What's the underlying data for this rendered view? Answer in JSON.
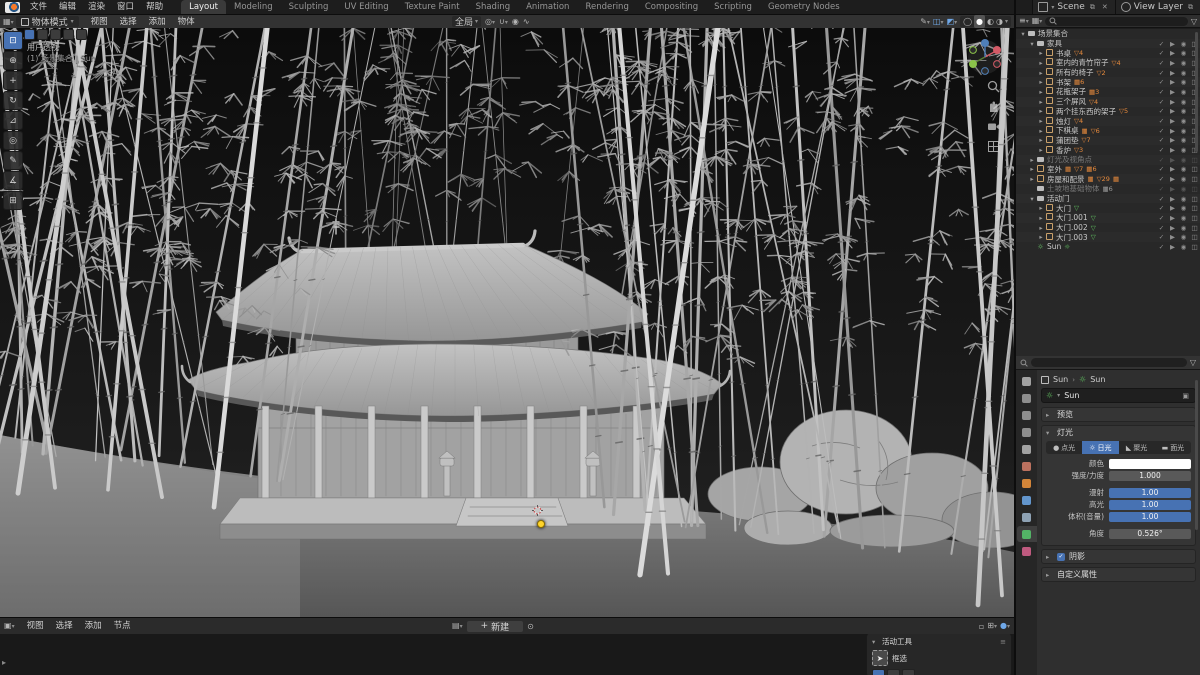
{
  "colors": {
    "accent": "#4772b3",
    "mesh_orange": "#e78a3c",
    "data_green": "#63c763",
    "sun_dot": "#ffd42a"
  },
  "topbar": {
    "menus": [
      "文件",
      "编辑",
      "渲染",
      "窗口",
      "帮助"
    ],
    "workspaces": [
      "Layout",
      "Modeling",
      "Sculpting",
      "UV Editing",
      "Texture Paint",
      "Shading",
      "Animation",
      "Rendering",
      "Compositing",
      "Scripting",
      "Geometry Nodes"
    ],
    "active_workspace": "Layout",
    "scene": "Scene",
    "view_layer": "View Layer"
  },
  "viewport_header": {
    "mode": "物体模式",
    "menus": [
      "视图",
      "选择",
      "添加",
      "物体"
    ],
    "orientation": "全局"
  },
  "viewport_overlay": {
    "view_label": "用户透视",
    "context_label": "(1) 场景集合 | Sun"
  },
  "toolbar": {
    "active_tool": "select-box",
    "tools": [
      "select-box",
      "cursor",
      "move",
      "rotate",
      "scale",
      "transform",
      "annotate",
      "measure",
      "add-cube"
    ]
  },
  "outliner": {
    "rows": [
      {
        "label": "场景集合",
        "type": "collection",
        "depth": 0,
        "expand": "open",
        "toggles": false
      },
      {
        "label": "家具",
        "type": "collection",
        "depth": 1,
        "expand": "open"
      },
      {
        "label": "书桌",
        "type": "object",
        "depth": 2,
        "expand": "closed",
        "badges": [
          {
            "glyph": "mesh",
            "count": "4",
            "color": "orange"
          }
        ]
      },
      {
        "label": "室内的青竹帘子",
        "type": "object",
        "depth": 2,
        "expand": "closed",
        "badges": [
          {
            "glyph": "mesh",
            "count": "4",
            "color": "orange"
          }
        ]
      },
      {
        "label": "所有的椅子",
        "type": "object",
        "depth": 2,
        "expand": "closed",
        "badges": [
          {
            "glyph": "mesh",
            "count": "2",
            "color": "orange"
          }
        ]
      },
      {
        "label": "书架",
        "type": "object",
        "depth": 2,
        "expand": "closed",
        "badges": [
          {
            "glyph": "img",
            "count": "6",
            "color": "orange"
          }
        ]
      },
      {
        "label": "花瓶架子",
        "type": "object",
        "depth": 2,
        "expand": "closed",
        "badges": [
          {
            "glyph": "img",
            "count": "3",
            "color": "orange"
          }
        ]
      },
      {
        "label": "三个屏风",
        "type": "object",
        "depth": 2,
        "expand": "closed",
        "badges": [
          {
            "glyph": "mesh",
            "count": "4",
            "color": "orange"
          }
        ]
      },
      {
        "label": "两个挂东西的架子",
        "type": "object",
        "depth": 2,
        "expand": "closed",
        "badges": [
          {
            "glyph": "mesh",
            "count": "5",
            "color": "orange"
          }
        ]
      },
      {
        "label": "烛灯",
        "type": "object",
        "depth": 2,
        "expand": "closed",
        "badges": [
          {
            "glyph": "mesh",
            "count": "4",
            "color": "orange"
          }
        ]
      },
      {
        "label": "下棋桌",
        "type": "object",
        "depth": 2,
        "expand": "closed",
        "badges": [
          {
            "glyph": "img",
            "count": "",
            "color": "orange"
          },
          {
            "glyph": "mesh",
            "count": "6",
            "color": "orange"
          }
        ]
      },
      {
        "label": "蒲团垫",
        "type": "object",
        "depth": 2,
        "expand": "closed",
        "badges": [
          {
            "glyph": "mesh",
            "count": "7",
            "color": "orange"
          }
        ]
      },
      {
        "label": "香炉",
        "type": "object",
        "depth": 2,
        "expand": "closed",
        "badges": [
          {
            "glyph": "mesh",
            "count": "3",
            "color": "orange"
          }
        ]
      },
      {
        "label": "灯光及视角点",
        "type": "collection",
        "depth": 1,
        "expand": "closed",
        "gray": true
      },
      {
        "label": "室外",
        "type": "object",
        "depth": 1,
        "expand": "closed",
        "badges": [
          {
            "glyph": "img",
            "count": "",
            "color": "orange"
          },
          {
            "glyph": "mesh",
            "count": "7",
            "color": "orange"
          },
          {
            "glyph": "img",
            "count": "6",
            "color": "orange"
          }
        ]
      },
      {
        "label": "房屋和配景",
        "type": "object",
        "depth": 1,
        "expand": "closed",
        "badges": [
          {
            "glyph": "img",
            "count": "",
            "color": "orange"
          },
          {
            "glyph": "mesh",
            "count": "29",
            "color": "orange"
          },
          {
            "glyph": "img",
            "count": "",
            "color": "orange"
          }
        ]
      },
      {
        "label": "土坡地基础物体",
        "type": "collection",
        "depth": 1,
        "expand": "none",
        "gray": true,
        "badges": [
          {
            "glyph": "img",
            "count": "6",
            "color": "gray"
          }
        ]
      },
      {
        "label": "活动门",
        "type": "collection",
        "depth": 1,
        "expand": "open"
      },
      {
        "label": "大门",
        "type": "object",
        "depth": 2,
        "expand": "closed",
        "badges": [
          {
            "glyph": "mesh",
            "count": "",
            "color": "green"
          }
        ]
      },
      {
        "label": "大门.001",
        "type": "object",
        "depth": 2,
        "expand": "closed",
        "badges": [
          {
            "glyph": "mesh",
            "count": "",
            "color": "green"
          }
        ]
      },
      {
        "label": "大门.002",
        "type": "object",
        "depth": 2,
        "expand": "closed",
        "badges": [
          {
            "glyph": "mesh",
            "count": "",
            "color": "green"
          }
        ]
      },
      {
        "label": "大门.003",
        "type": "object",
        "depth": 2,
        "expand": "closed",
        "badges": [
          {
            "glyph": "mesh",
            "count": "",
            "color": "green"
          }
        ]
      },
      {
        "label": "Sun",
        "type": "light",
        "depth": 1,
        "expand": "none",
        "badges": [
          {
            "glyph": "sun",
            "count": "",
            "color": "green"
          }
        ]
      }
    ]
  },
  "properties": {
    "active_tab": "object-data",
    "tabs": [
      {
        "name": "tool",
        "color": "#b0b0b0"
      },
      {
        "name": "render",
        "color": "#9a9a9a"
      },
      {
        "name": "output",
        "color": "#9a9a9a"
      },
      {
        "name": "view-layer",
        "color": "#9a9a9a"
      },
      {
        "name": "scene",
        "color": "#b0b0b0"
      },
      {
        "name": "world",
        "color": "#cc7a66"
      },
      {
        "name": "object",
        "color": "#e7903c"
      },
      {
        "name": "physics",
        "color": "#6aa3e0"
      },
      {
        "name": "constraints",
        "color": "#9ab0c4"
      },
      {
        "name": "object-data",
        "color": "#55c06a"
      },
      {
        "name": "texture",
        "color": "#d0608a"
      }
    ],
    "breadcrumb": {
      "object": "Sun",
      "data": "Sun"
    },
    "datablock": "Sun",
    "panels": {
      "preview": "预览",
      "light": "灯光",
      "shadow": "阴影",
      "custom": "自定义属性"
    },
    "light": {
      "active": "日光",
      "types": [
        {
          "label": "点光",
          "icon": "●"
        },
        {
          "label": "日光",
          "icon": "☼"
        },
        {
          "label": "聚光",
          "icon": "◣"
        },
        {
          "label": "面光",
          "icon": "▬"
        }
      ],
      "rows": [
        {
          "label": "颜色",
          "kind": "color",
          "value": ""
        },
        {
          "label": "强度/力度",
          "kind": "value",
          "value": "1.000"
        },
        {
          "label": "漫射",
          "kind": "slider",
          "value": "1.00",
          "gap": true
        },
        {
          "label": "高光",
          "kind": "slider",
          "value": "1.00"
        },
        {
          "label": "体积(音量)",
          "kind": "slider",
          "value": "1.00"
        },
        {
          "label": "角度",
          "kind": "value",
          "value": "0.526°",
          "gap": true
        }
      ]
    }
  },
  "node_editor": {
    "menus": [
      "视图",
      "选择",
      "添加",
      "节点"
    ],
    "new_label": "新建",
    "tool_panel": {
      "title": "活动工具",
      "tool": "框选"
    }
  }
}
